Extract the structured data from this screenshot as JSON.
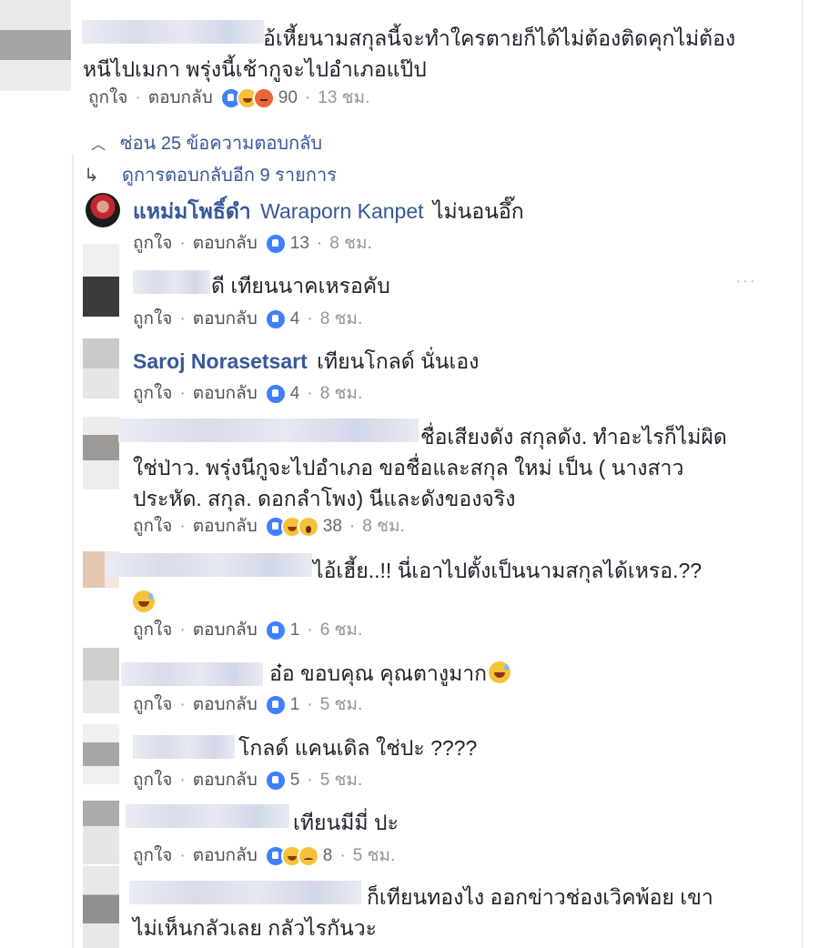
{
  "top_comment": {
    "line1": "อ้เหี้ยนามสกุลนี้จะทำใครตายก็ได้ไม่ต้องติดคุกไม่ต้อง",
    "line2": "หนีไปเมกา พรุ่งนี้เช้ากูจะไปอำเภอแป๊ป",
    "like": "ถูกใจ",
    "reply": "ตอบกลับ",
    "reaction_count": "90",
    "time": "13 ชม.",
    "reactions": [
      "like-icon",
      "haha-icon",
      "angry-icon"
    ]
  },
  "hide_replies": {
    "icon": "chevron-up-icon",
    "label": "ซ่อน 25 ข้อความตอบกลับ"
  },
  "more_replies": {
    "icon": "reply-arrow-icon",
    "label": "ดูการตอบกลับอีก 9 รายการ"
  },
  "replies": [
    {
      "name": "แหม่มโพธิ์ดำ",
      "tag": "Waraporn Kanpet",
      "text": "ไม่นอนอึ๊ก",
      "like": "ถูกใจ",
      "reply": "ตอบกลับ",
      "count": "13",
      "time": "8 ชม."
    },
    {
      "text": "ดี เทียนนาคเหรอคับ",
      "like": "ถูกใจ",
      "reply": "ตอบกลับ",
      "count": "4",
      "time": "8 ชม.",
      "more": "···"
    },
    {
      "name": "Saroj Norasetsart",
      "text": "เทียนโกลด์ นั่นเอง",
      "like": "ถูกใจ",
      "reply": "ตอบกลับ",
      "count": "4",
      "time": "8 ชม."
    },
    {
      "line1": "ชื่อเสียงดัง สกุลดัง. ทำอะไรก็ไม่ผิด",
      "line2": "ใช่ป่าว. พรุ่งนีกูจะไปอำเภอ ขอชื่อและสกุล ใหม่ เป็น ( นางสาว",
      "line3": "ประหัด. สกุล. ดอกลำโพง) นีและดังของจริง",
      "like": "ถูกใจ",
      "reply": "ตอบกลับ",
      "count": "38",
      "time": "8 ชม."
    },
    {
      "line1": "ไอ้เฮี้ย..!! นี่เอาไปตั้งเป็นนามสกุลได้เหรอ.??",
      "like": "ถูกใจ",
      "reply": "ตอบกลับ",
      "count": "1",
      "time": "6 ชม."
    },
    {
      "text": "อ๋อ ขอบคุณ คุณตางูมาก",
      "like": "ถูกใจ",
      "reply": "ตอบกลับ",
      "count": "1",
      "time": "5 ชม."
    },
    {
      "text": "โกลด์ แคนเดิล ใช่ปะ ????",
      "like": "ถูกใจ",
      "reply": "ตอบกลับ",
      "count": "5",
      "time": "5 ชม."
    },
    {
      "text": "เทียนมีมี่ ปะ",
      "like": "ถูกใจ",
      "reply": "ตอบกลับ",
      "count": "8",
      "time": "5 ชม."
    },
    {
      "line1": "ก็เทียนทองไง ออกข่าวช่องเวิคพ้อย เขา",
      "line2": "ไม่เห็นกลัวเลย กลัวไรกันวะ"
    }
  ],
  "colors": {
    "link": "#365899",
    "meta": "#90949c",
    "like_blue": "#4080ff",
    "haha_yellow": "#f7c23b",
    "angry_orange": "#e8663b"
  }
}
